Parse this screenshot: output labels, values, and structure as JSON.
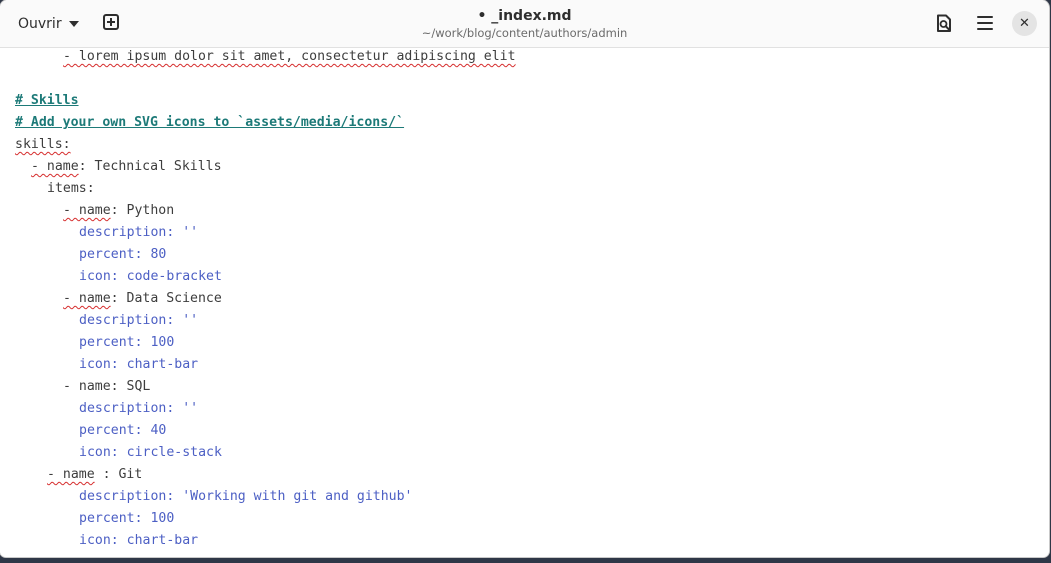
{
  "header": {
    "open_label": "Ouvrir",
    "title": "• _index.md",
    "subtitle": "~/work/blog/content/authors/admin"
  },
  "icons": {
    "new_tab": "new-tab-icon",
    "preview": "document-preview-icon",
    "menu": "hamburger-menu-icon",
    "close": "close-icon"
  },
  "editor": {
    "lines": {
      "l1": "- lorem ipsum dolor sit amet, consectetur adipiscing elit",
      "l3": "# Skills",
      "l4": "# Add your own SVG icons to `assets/media/icons/`",
      "l5": "skills:",
      "l6_dash": "- name",
      "l6_rest": ": Technical Skills",
      "l7": "items:",
      "l8_dash": "- name",
      "l8_rest": ": Python",
      "l9": "description: ''",
      "l10": "percent: 80",
      "l11": "icon: code-bracket",
      "l12_dash": "- name",
      "l12_rest": ": Data Science",
      "l13": "description: ''",
      "l14": "percent: 100",
      "l15": "icon: chart-bar",
      "l16": "- name: SQL",
      "l17": "description: ''",
      "l18": "percent: 40",
      "l19": "icon: circle-stack",
      "l20_dash": "- name",
      "l20_rest": " : Git",
      "l21": "description: 'Working with git and github'",
      "l22": "percent: 100",
      "l23": "icon: chart-bar"
    }
  },
  "colors": {
    "heading": "#1d7a78",
    "value_blue": "#4c5fc4",
    "spell_error": "#d62d2d"
  }
}
